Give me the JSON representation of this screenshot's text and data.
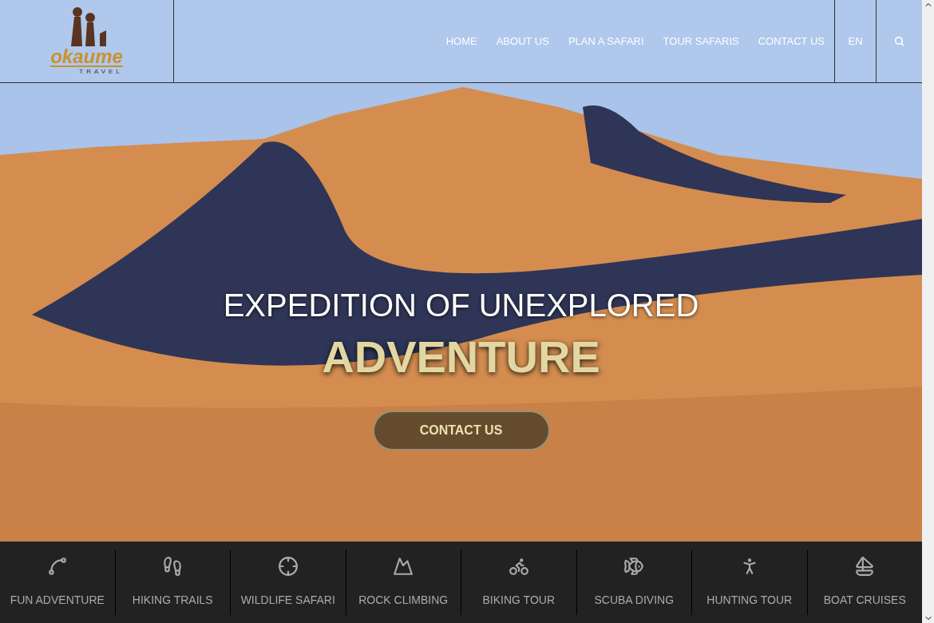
{
  "logo": {
    "name": "okaume",
    "tagline": "TRAVEL"
  },
  "nav": [
    {
      "label": "HOME"
    },
    {
      "label": "ABOUT US"
    },
    {
      "label": "PLAN A SAFARI"
    },
    {
      "label": "TOUR SAFARIS"
    },
    {
      "label": "CONTACT US"
    }
  ],
  "language": "EN",
  "hero": {
    "title": "EXPEDITION OF UNEXPLORED",
    "highlight": "ADVENTURE",
    "button": "CONTACT US"
  },
  "activities": [
    {
      "label": "FUN ADVENTURE"
    },
    {
      "label": "HIKING TRAILS"
    },
    {
      "label": "WILDLIFE SAFARI"
    },
    {
      "label": "ROCK CLIMBING"
    },
    {
      "label": "BIKING TOUR"
    },
    {
      "label": "SCUBA DIVING"
    },
    {
      "label": "HUNTING TOUR"
    },
    {
      "label": "BOAT CRUISES"
    }
  ]
}
